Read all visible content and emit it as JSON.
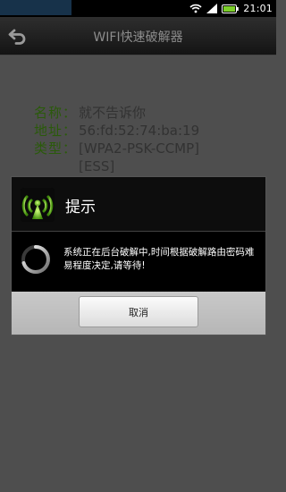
{
  "status_bar": {
    "time": "21:01",
    "icons": [
      "wifi-icon",
      "signal-icon",
      "battery-icon"
    ]
  },
  "title_bar": {
    "title": "WIFI快速破解器",
    "back_icon": "back-arrow-icon"
  },
  "network_info": {
    "name_label": "名称：",
    "name_value": "就不告诉你",
    "address_label": "地址：",
    "address_value": "56:fd:52:74:ba:19",
    "type_label": "类型：",
    "type_value": "[WPA2-PSK-CCMP][ESS]"
  },
  "dialog": {
    "title": "提示",
    "icon": "wifi-antenna-icon",
    "message": "系统正在后台破解中,时间根据破解路由密码难易程度决定,请等待!",
    "cancel_label": "取消"
  },
  "colors": {
    "label_green": "#2a5a0a",
    "overlay_grey": "#4e4e4e",
    "dialog_bg": "#000000"
  }
}
